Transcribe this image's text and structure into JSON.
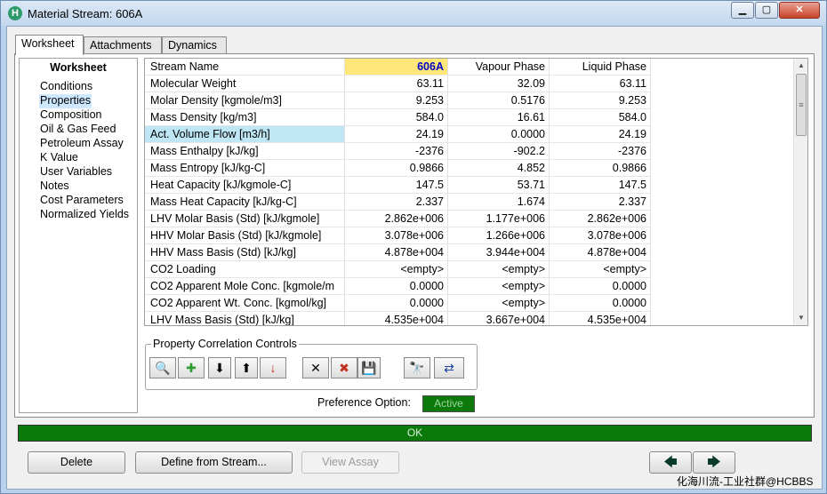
{
  "window": {
    "title": "Material Stream: 606A",
    "app_icon_letter": "H"
  },
  "tabs": [
    "Worksheet",
    "Attachments",
    "Dynamics"
  ],
  "nav": {
    "heading": "Worksheet",
    "items": [
      "Conditions",
      "Properties",
      "Composition",
      "Oil & Gas Feed",
      "Petroleum Assay",
      "K Value",
      "User Variables",
      "Notes",
      "Cost Parameters",
      "Normalized Yields"
    ],
    "selected": "Properties"
  },
  "grid": {
    "header": [
      "Stream Name",
      "606A",
      "Vapour Phase",
      "Liquid Phase"
    ],
    "rows": [
      [
        "Molecular Weight",
        "63.11",
        "32.09",
        "63.11"
      ],
      [
        "Molar Density [kgmole/m3]",
        "9.253",
        "0.5176",
        "9.253"
      ],
      [
        "Mass Density [kg/m3]",
        "584.0",
        "16.61",
        "584.0"
      ],
      [
        "Act. Volume Flow [m3/h]",
        "24.19",
        "0.0000",
        "24.19"
      ],
      [
        "Mass Enthalpy [kJ/kg]",
        "-2376",
        "-902.2",
        "-2376"
      ],
      [
        "Mass Entropy [kJ/kg-C]",
        "0.9866",
        "4.852",
        "0.9866"
      ],
      [
        "Heat Capacity [kJ/kgmole-C]",
        "147.5",
        "53.71",
        "147.5"
      ],
      [
        "Mass Heat Capacity [kJ/kg-C]",
        "2.337",
        "1.674",
        "2.337"
      ],
      [
        "LHV Molar Basis (Std) [kJ/kgmole]",
        "2.862e+006",
        "1.177e+006",
        "2.862e+006"
      ],
      [
        "HHV Molar Basis (Std) [kJ/kgmole]",
        "3.078e+006",
        "1.266e+006",
        "3.078e+006"
      ],
      [
        "HHV Mass Basis (Std) [kJ/kg]",
        "4.878e+004",
        "3.944e+004",
        "4.878e+004"
      ],
      [
        "CO2 Loading",
        "<empty>",
        "<empty>",
        "<empty>"
      ],
      [
        "CO2 Apparent Mole Conc. [kgmole/m",
        "0.0000",
        "<empty>",
        "0.0000"
      ],
      [
        "CO2 Apparent Wt. Conc. [kgmol/kg]",
        "0.0000",
        "<empty>",
        "0.0000"
      ],
      [
        "LHV Mass Basis (Std) [kJ/kg]",
        "4.535e+004",
        "3.667e+004",
        "4.535e+004"
      ]
    ],
    "highlighted_row": 3
  },
  "correlation": {
    "label": "Property Correlation Controls",
    "toolbar": [
      {
        "icon": "view-correlation-icon",
        "glyph": "🔍"
      },
      {
        "icon": "add-icon",
        "glyph": "✚"
      },
      {
        "icon": "move-down-icon",
        "glyph": "⬇"
      },
      {
        "icon": "move-up-icon",
        "glyph": "⬆"
      },
      {
        "icon": "sort-icon",
        "glyph": "↓"
      },
      {
        "icon": "delete-icon",
        "glyph": "✕"
      },
      {
        "icon": "delete-all-icon",
        "glyph": "✖"
      },
      {
        "icon": "save-icon",
        "glyph": "💾"
      },
      {
        "icon": "find-icon",
        "glyph": "🔭"
      },
      {
        "icon": "transfer-icon",
        "glyph": "⇄"
      }
    ]
  },
  "preference": {
    "label": "Preference Option:",
    "value": "Active"
  },
  "status": {
    "text": "OK",
    "color": "#0b7a0b"
  },
  "buttons": {
    "delete": "Delete",
    "define_from_stream": "Define from Stream...",
    "view_assay": "View Assay",
    "prev_glyph": "🡄",
    "next_glyph": "🡆"
  },
  "watermark": "化海川流-工业社群@HCBBS"
}
